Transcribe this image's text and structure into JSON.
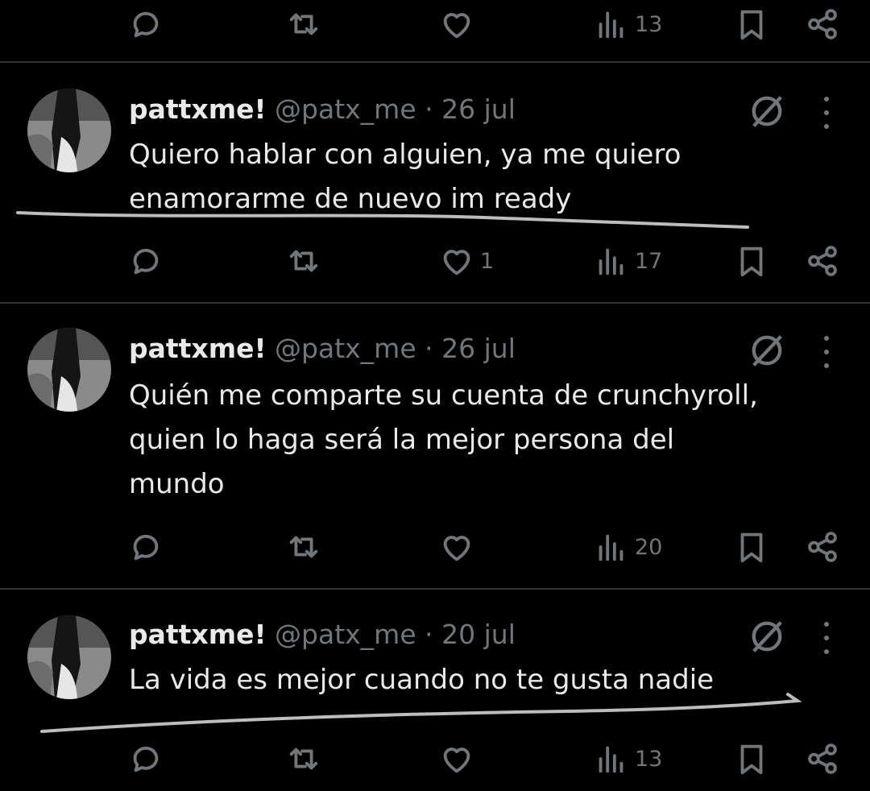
{
  "actions_top": {
    "views": "13"
  },
  "tweets": [
    {
      "name": "pattxme!",
      "handle": "@patx_me",
      "separator": "·",
      "date": "26 jul",
      "lines": [
        "Quiero hablar con alguien, ya me quiero",
        "enamorarme de nuevo im ready"
      ],
      "likes": "1",
      "views": "17"
    },
    {
      "name": "pattxme!",
      "handle": "@patx_me",
      "separator": "·",
      "date": "26 jul",
      "lines": [
        "Quién me comparte su cuenta de crunchyroll,",
        "quien lo haga será la mejor persona del",
        "mundo"
      ],
      "likes": "",
      "views": "20"
    },
    {
      "name": "pattxme!",
      "handle": "@patx_me",
      "separator": "·",
      "date": "20 jul",
      "lines": [
        "La vida es mejor cuando no te gusta nadie"
      ],
      "likes": "",
      "views": "13"
    }
  ],
  "colors": {
    "background": "#000000",
    "text": "#e7e9ea",
    "muted": "#71767b",
    "divider": "#2f3336",
    "scribble": "#bdbdbd"
  },
  "icons": [
    "reply-icon",
    "retweet-icon",
    "like-icon",
    "views-icon",
    "bookmark-icon",
    "share-icon",
    "grok-icon",
    "more-icon"
  ]
}
